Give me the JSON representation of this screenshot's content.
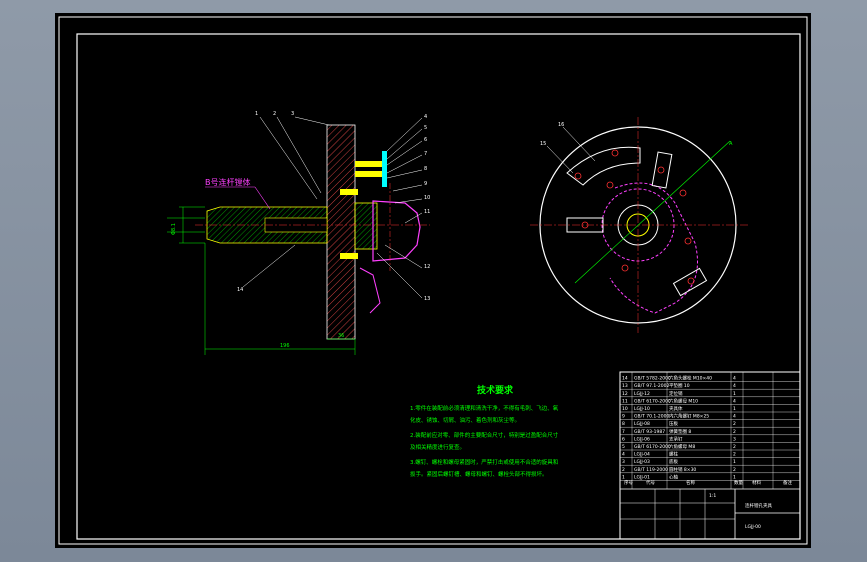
{
  "side_view": {
    "part_label": "B号连杆镗体",
    "dim_total": "196",
    "dim_base": "36",
    "dim_dia": "Φ8.1",
    "callouts": [
      "1",
      "2",
      "3",
      "4",
      "5",
      "6",
      "7",
      "8",
      "9",
      "10",
      "11",
      "12",
      "13",
      "14"
    ]
  },
  "front_view": {
    "callouts": [
      "15",
      "16",
      "A"
    ]
  },
  "notes": {
    "title": "技术要求",
    "lines": [
      "1.零件在装配前必须清理和清洗干净，不得有毛刺、飞边、氧",
      "  化皮、锈蚀、切屑、油污、着色剂和灰尘等。",
      "2.装配前应对零、部件的主要配合尺寸，特别是过盈配合尺寸",
      "  及相关精度进行复查。",
      "3.螺钉、螺栓和螺母紧固时，严禁打击或使用不合适的旋具和",
      "  扳手。紧固后螺钉槽、螺母和螺钉、螺栓头部不得损坏。"
    ]
  },
  "title_block": {
    "rows": [
      {
        "no": "14",
        "code": "GB/T 5782-2000",
        "name": "六角头螺栓 M10×40",
        "qty": "4"
      },
      {
        "no": "13",
        "code": "GB/T 97.1-2002",
        "name": "平垫圈 10",
        "qty": "4"
      },
      {
        "no": "12",
        "code": "LGJJ-12",
        "name": "定位销",
        "qty": "1"
      },
      {
        "no": "11",
        "code": "GB/T 6170-2000",
        "name": "六角螺母 M10",
        "qty": "4"
      },
      {
        "no": "10",
        "code": "LGJJ-10",
        "name": "夹具体",
        "qty": "1"
      },
      {
        "no": "9",
        "code": "GB/T 70.1-2000",
        "name": "内六角螺钉 M8×25",
        "qty": "4"
      },
      {
        "no": "8",
        "code": "LGJJ-08",
        "name": "压板",
        "qty": "2"
      },
      {
        "no": "7",
        "code": "GB/T 93-1987",
        "name": "弹簧垫圈 8",
        "qty": "2"
      },
      {
        "no": "6",
        "code": "LGJJ-06",
        "name": "支承钉",
        "qty": "3"
      },
      {
        "no": "5",
        "code": "GB/T 6170-2000",
        "name": "六角螺母 M8",
        "qty": "2"
      },
      {
        "no": "4",
        "code": "LGJJ-04",
        "name": "螺柱",
        "qty": "2"
      },
      {
        "no": "3",
        "code": "LGJJ-03",
        "name": "底板",
        "qty": "1"
      },
      {
        "no": "2",
        "code": "GB/T 119-2000",
        "name": "圆柱销 8×30",
        "qty": "2"
      },
      {
        "no": "1",
        "code": "LGJJ-01",
        "name": "心轴",
        "qty": "1"
      }
    ],
    "header": {
      "no": "序号",
      "code": "代号",
      "name": "名称",
      "qty": "数量",
      "material": "材料",
      "note": "备注"
    },
    "drawing_title": "连杆镗孔夹具",
    "drawing_no": "LGJJ-00",
    "scale": "1:1"
  },
  "colors": {
    "frame": "#ffffff",
    "part": "#ffff00",
    "hatch": "#00ff00",
    "center": "#ff3030",
    "accent": "#ff40ff",
    "workpiece": "#00ffff"
  }
}
